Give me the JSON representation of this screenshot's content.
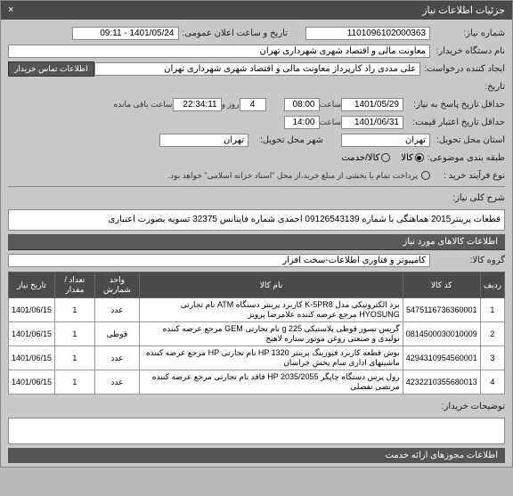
{
  "header": {
    "title": "جزئیات اطلاعات نیاز",
    "close": "×"
  },
  "fields": {
    "need_number_label": "شماره نیاز:",
    "need_number": "1101096102000363",
    "announce_label": "تاریخ و ساعت اعلان عمومی:",
    "announce_value": "1401/05/24 - 09:11",
    "buyer_label": "نام دستگاه خریدار:",
    "buyer_value": "معاونت مالی و اقتصاد شهری شهرداری تهران",
    "requester_label": "ایجاد کننده درخواست:",
    "requester_value": "علی مددی راد کارپرداز معاونت مالی و اقتصاد شهری شهرداری تهران",
    "contact_btn": "اطلاعات تماس خریدار",
    "date_label": "تاریخ:",
    "reply_deadline_label": "حداقل تاریخ پاسخ به نیاز:",
    "reply_date": "1401/05/29",
    "time_label": "ساعت",
    "reply_time": "08:00",
    "days_count": "4",
    "days_and": "روز و",
    "remaining_time": "22:34:11",
    "remaining_label": "ساعت باقی مانده",
    "validity_label": "حداقل تاریخ اعتبار قیمت:",
    "validity_date": "1401/06/31",
    "validity_time": "14:00",
    "province_label": "استان محل تحویل:",
    "province_value": "تهران",
    "city_label": "شهر محل تحویل:",
    "city_value": "تهران",
    "category_label": "طبقه بندی موضوعی:",
    "cat_goods": "کالا",
    "cat_service": "کالا/خدمت",
    "buy_method_label": "نوع فرآیند خرید :",
    "buy_method_note": "پرداخت تمام یا بخشی از مبلغ خرید،از محل \"اسناد خزانه اسلامی\" خواهد بود.",
    "need_desc_label": "شرح کلی نیاز:",
    "need_desc": "قطعات پرینتر2015 هماهنگی با شماره 09126543139 احمدی شماره فاینانس 32375 تسویه بصورت اعتباری",
    "goods_info_label": "اطلاعات کالاهای مورد نیاز",
    "group_label": "گروه کالا:",
    "group_value": "کامپیوتر و فناوری اطلاعات-سخت افزار",
    "notes_label": "توضیحات خریدار:",
    "licenses_label": "اطلاعات مجوزهای ارائه خدمت"
  },
  "table": {
    "headers": {
      "row": "ردیف",
      "code": "کد کالا",
      "name": "نام کالا",
      "unit": "واحد شمارش",
      "qty": "تعداد / مقدار",
      "date": "تاریخ نیاز"
    },
    "rows": [
      {
        "n": "1",
        "code": "5475116736360001",
        "name": "برد الکترونیکی مدل K-5PR8 کاربرد پرینتر دستگاه ATM نام تجارتی HYOSUNG مرجع عرضه کننده علامرضا پرویز",
        "unit": "عدد",
        "qty": "1",
        "date": "1401/06/15"
      },
      {
        "n": "2",
        "code": "0814500030010009",
        "name": "گریس نسوز قوطی پلاستیکی 225 g نام تجارتی GEM مرجع عرضه کننده تولیدی و صنعتی روغن موتور ستاره لاهیج",
        "unit": "قوطی",
        "qty": "1",
        "date": "1401/06/15"
      },
      {
        "n": "3",
        "code": "4294310954560001",
        "name": "بوش قطعه کاربرد فیوزینگ پرینتر HP 1320 نام تجارتی HP مرجع عرضه کننده ماشینهای اداری سام پخش خراسان",
        "unit": "عدد",
        "qty": "1",
        "date": "1401/06/15"
      },
      {
        "n": "4",
        "code": "4232210355680013",
        "name": "رول پرس دستگاه چاپگر HP 2035/2055 فاقد نام تجارتی مرجع عرضه کننده مرتضی تفضلی",
        "unit": "عدد",
        "qty": "1",
        "date": "1401/06/15"
      }
    ]
  }
}
